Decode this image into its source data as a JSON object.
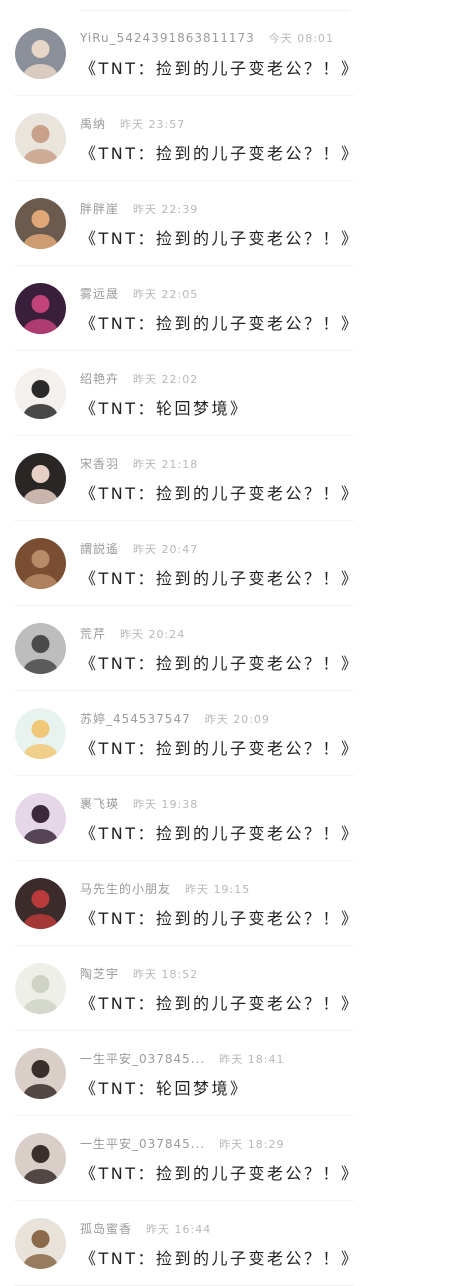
{
  "comments": [
    {
      "username": "YiRu_5424391863811173",
      "time": "今天 08:01",
      "text": "《TNT：捡到的儿子变老公？！》",
      "avatar_bg": "#8a8f9a",
      "avatar_fg": "#e8d6c8"
    },
    {
      "username": "禹纳",
      "time": "昨天 23:57",
      "text": "《TNT：捡到的儿子变老公？！》",
      "avatar_bg": "#e9e4dc",
      "avatar_fg": "#c9a18a"
    },
    {
      "username": "胖胖崖",
      "time": "昨天 22:39",
      "text": "《TNT：捡到的儿子变老公？！》",
      "avatar_bg": "#6b5a4e",
      "avatar_fg": "#e0a878"
    },
    {
      "username": "雾远晟",
      "time": "昨天 22:05",
      "text": "《TNT：捡到的儿子变老公？！》",
      "avatar_bg": "#3a1f3d",
      "avatar_fg": "#c2437a"
    },
    {
      "username": "绍艳卉",
      "time": "昨天 22:02",
      "text": "《TNT：轮回梦境》",
      "avatar_bg": "#f4f0ee",
      "avatar_fg": "#2a2a2a"
    },
    {
      "username": "宋香羽",
      "time": "昨天 21:18",
      "text": "《TNT：捡到的儿子变老公？！》",
      "avatar_bg": "#2b2626",
      "avatar_fg": "#e6cfc4"
    },
    {
      "username": "謂説遙",
      "time": "昨天 20:47",
      "text": "《TNT：捡到的儿子变老公？！》",
      "avatar_bg": "#7a4e33",
      "avatar_fg": "#b98a66"
    },
    {
      "username": "荒芹",
      "time": "昨天 20:24",
      "text": "《TNT：捡到的儿子变老公？！》",
      "avatar_bg": "#bdbdbd",
      "avatar_fg": "#4a4a4a"
    },
    {
      "username": "苏婷_454537547",
      "time": "昨天 20:09",
      "text": "《TNT：捡到的儿子变老公？！》",
      "avatar_bg": "#e8f3f0",
      "avatar_fg": "#f0c878"
    },
    {
      "username": "裹飞瑛",
      "time": "昨天 19:38",
      "text": "《TNT：捡到的儿子变老公？！》",
      "avatar_bg": "#e6d7e8",
      "avatar_fg": "#3a2a3a"
    },
    {
      "username": "马先生的小朋友",
      "time": "昨天 19:15",
      "text": "《TNT：捡到的儿子变老公？！》",
      "avatar_bg": "#3b2b2b",
      "avatar_fg": "#b83a3a"
    },
    {
      "username": "陶芝宇",
      "time": "昨天 18:52",
      "text": "《TNT：捡到的儿子变老公？！》",
      "avatar_bg": "#eef0e8",
      "avatar_fg": "#cfd3c6"
    },
    {
      "username": "一生平安_037845...",
      "time": "昨天 18:41",
      "text": "《TNT：轮回梦境》",
      "avatar_bg": "#d9cfc8",
      "avatar_fg": "#3a2f2a"
    },
    {
      "username": "一生平安_037845...",
      "time": "昨天 18:29",
      "text": "《TNT：捡到的儿子变老公？！》",
      "avatar_bg": "#d9cfc8",
      "avatar_fg": "#3a2f2a"
    },
    {
      "username": "孤岛蜜香",
      "time": "昨天 16:44",
      "text": "《TNT：捡到的儿子变老公？！》",
      "avatar_bg": "#e8e2da",
      "avatar_fg": "#8a6a4a"
    }
  ]
}
